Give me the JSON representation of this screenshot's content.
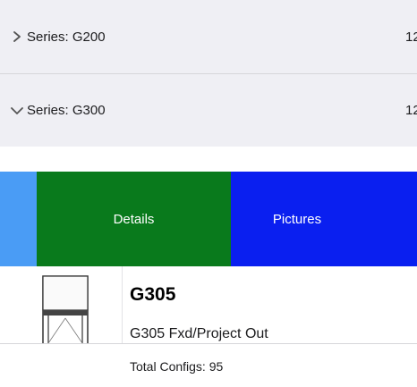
{
  "series_list": [
    {
      "label": "Series: G200",
      "count": "12",
      "expanded": false,
      "icon": "chevron-right-icon"
    },
    {
      "label": "Series: G300",
      "count": "12",
      "expanded": true,
      "icon": "chevron-down-icon"
    }
  ],
  "swipe_actions": {
    "details_label": "Details",
    "pictures_label": "Pictures",
    "details_color": "#097a1c",
    "pictures_color": "#0a1ff0",
    "edge_color": "#4a9cf5"
  },
  "product": {
    "name": "G305",
    "description": "G305 Fxd/Project Out",
    "thumbnail_icon": "window-thumbnail-icon"
  },
  "footer": {
    "total_configs": "Total Configs: 95"
  }
}
